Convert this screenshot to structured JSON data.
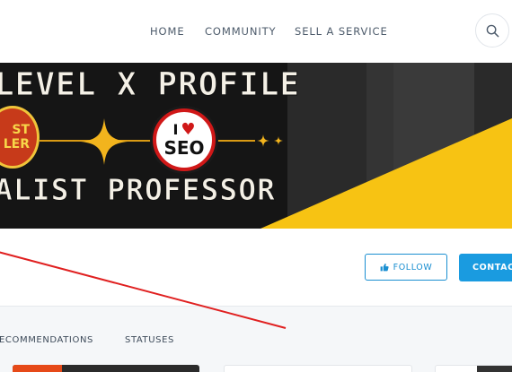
{
  "nav": {
    "items": [
      {
        "label": "HOME"
      },
      {
        "label": "COMMUNITY"
      },
      {
        "label": "SELL A SERVICE"
      }
    ],
    "search_icon": "search-icon"
  },
  "banner": {
    "line1": "LEVEL X PROFILE",
    "line2": "ALIST PROFESSOR",
    "badge_left": [
      "ST",
      "LER"
    ],
    "badge_seo": {
      "top": "I",
      "heart": "♥",
      "bottom": "SEO"
    },
    "colors": {
      "background": "#151515",
      "accent": "#f7c313"
    }
  },
  "actions": {
    "follow_label": "FOLLOW",
    "follow_icon": "thumbs-up-icon",
    "contact_label": "CONTACT"
  },
  "tabs": [
    {
      "label": "ECOMMENDATIONS"
    },
    {
      "label": "STATUSES"
    }
  ],
  "colors": {
    "primary": "#1a9be0",
    "annotation": "#e02020"
  }
}
